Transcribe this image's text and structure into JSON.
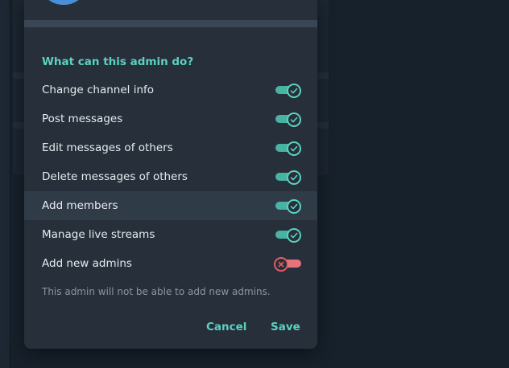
{
  "permissions": {
    "title": "What can this admin do?",
    "items": [
      {
        "label": "Change channel info",
        "enabled": true
      },
      {
        "label": "Post messages",
        "enabled": true
      },
      {
        "label": "Edit messages of others",
        "enabled": true
      },
      {
        "label": "Delete messages of others",
        "enabled": true
      },
      {
        "label": "Add members",
        "enabled": true
      },
      {
        "label": "Manage live streams",
        "enabled": true
      },
      {
        "label": "Add new admins",
        "enabled": false
      }
    ],
    "note": "This admin will not be able to add new admins."
  },
  "buttons": {
    "cancel": "Cancel",
    "save": "Save"
  },
  "icons": {
    "on": "check-icon",
    "off": "cross-icon"
  },
  "colors": {
    "accent": "#5ad2c0",
    "toggle_on": "#48b3a3",
    "toggle_off": "#e05e66",
    "dialog_bg": "#272f3a"
  }
}
